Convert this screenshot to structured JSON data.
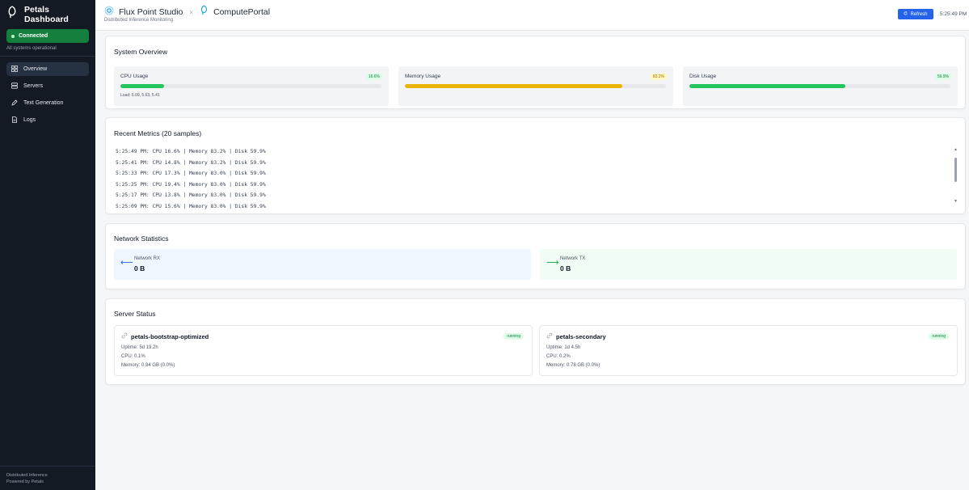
{
  "sidebar": {
    "brand": "Petals Dashboard",
    "connection": {
      "label": "Connected",
      "subtext": "All systems operational"
    },
    "nav": [
      {
        "label": "Overview",
        "icon": "grid-icon",
        "active": true
      },
      {
        "label": "Servers",
        "icon": "server-icon",
        "active": false
      },
      {
        "label": "Text Generation",
        "icon": "pen-icon",
        "active": false
      },
      {
        "label": "Logs",
        "icon": "document-icon",
        "active": false
      }
    ],
    "footer": {
      "line1": "Distributed Inference",
      "line2": "Powered by Petals"
    }
  },
  "header": {
    "org": "Flux Point Studio",
    "separator": "×",
    "app": "ComputePortal",
    "subtitle": "Distributed Inference Monitoring",
    "refresh_label": "Refresh",
    "time": "5:25:49 PM"
  },
  "overview": {
    "title": "System Overview",
    "cpu": {
      "label": "CPU Usage",
      "value": "16.6%",
      "percent": 16.6,
      "load": "Load: 6.09, 5.63, 5.41",
      "color": "#22c55e"
    },
    "memory": {
      "label": "Memory Usage",
      "value": "83.2%",
      "percent": 83.2,
      "color": "#eab308"
    },
    "disk": {
      "label": "Disk Usage",
      "value": "59.9%",
      "percent": 59.9,
      "color": "#22c55e"
    }
  },
  "metrics": {
    "title": "Recent Metrics (20 samples)",
    "lines": [
      "5:25:49 PM: CPU 16.6% | Memory 83.2% | Disk 59.9%",
      "5:25:41 PM: CPU 14.8% | Memory 83.2% | Disk 59.9%",
      "5:25:33 PM: CPU 17.3% | Memory 83.0% | Disk 59.9%",
      "5:25:25 PM: CPU 19.4% | Memory 83.0% | Disk 59.9%",
      "5:25:17 PM: CPU 13.8% | Memory 83.0% | Disk 59.9%",
      "5:25:09 PM: CPU 15.6% | Memory 83.0% | Disk 59.9%"
    ]
  },
  "network": {
    "title": "Network Statistics",
    "rx": {
      "label": "Network RX",
      "value": "0 B",
      "arrow": "⟵"
    },
    "tx": {
      "label": "Network TX",
      "value": "0 B",
      "arrow": "⟶"
    }
  },
  "servers": {
    "title": "Server Status",
    "items": [
      {
        "name": "petals-bootstrap-optimized",
        "status": "running",
        "uptime": "Uptime: 5d 19.2h",
        "cpu": "CPU: 0.1%",
        "memory": "Memory: 0.94 GB (0.0%)"
      },
      {
        "name": "petals-secondary",
        "status": "running",
        "uptime": "Uptime: 1d 4.5h",
        "cpu": "CPU: 0.2%",
        "memory": "Memory: 0.78 GB (0.0%)"
      }
    ]
  }
}
